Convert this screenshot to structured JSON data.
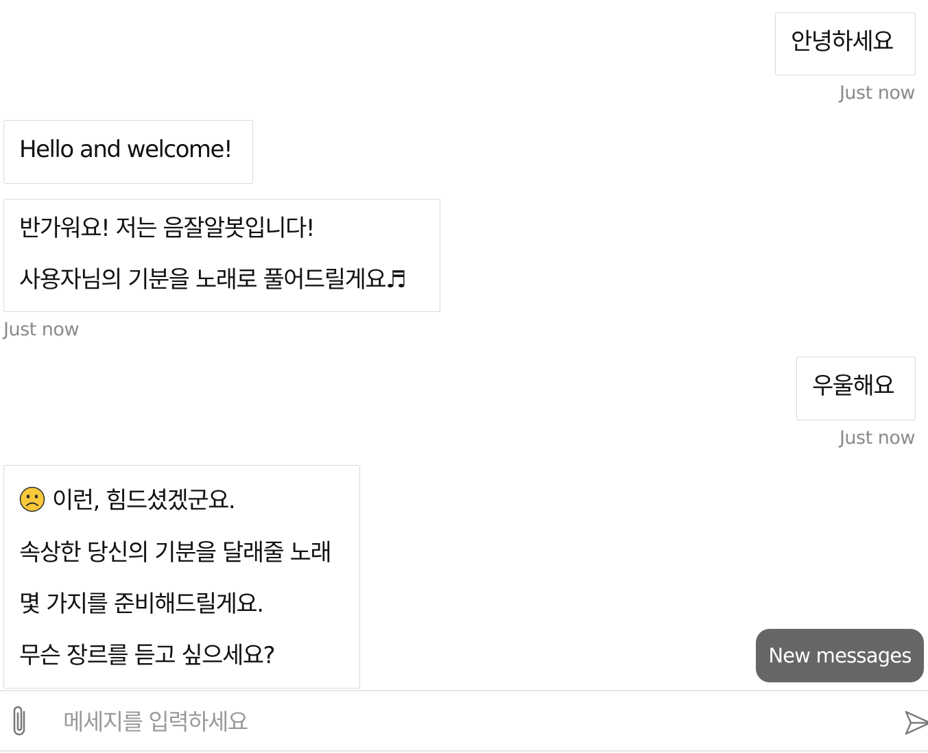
{
  "chat": {
    "messages": [
      {
        "sender": "user",
        "lines": [
          "안녕하세요"
        ],
        "time": "Just now"
      },
      {
        "sender": "bot",
        "lines": [
          "Hello and welcome!"
        ]
      },
      {
        "sender": "bot",
        "lines": [
          "반가워요! 저는 음잘알봇입니다!",
          "사용자님의 기분을 노래로 풀어드릴게요♬"
        ],
        "time": "Just now"
      },
      {
        "sender": "user",
        "lines": [
          "우울해요"
        ],
        "time": "Just now"
      },
      {
        "sender": "bot",
        "lines": [
          "이런, 힘드셨겠군요.",
          "속상한 당신의 기분을 달래줄 노래",
          "몇 가지를 준비해드릴게요.",
          "무슨 장르를 듣고 싶으세요?"
        ],
        "icon": "slightly-frowning-face-emoji"
      }
    ],
    "new_messages_label": "New messages"
  },
  "composer": {
    "placeholder": "메세지를 입력하세요",
    "value": "",
    "attach_icon": "paperclip-icon",
    "send_icon": "send-icon"
  },
  "colors": {
    "bubble_border": "#d8d8d8",
    "timestamp": "#8a8a8a",
    "new_messages_bg": "#666666",
    "emoji_face": "#f7c83a"
  }
}
